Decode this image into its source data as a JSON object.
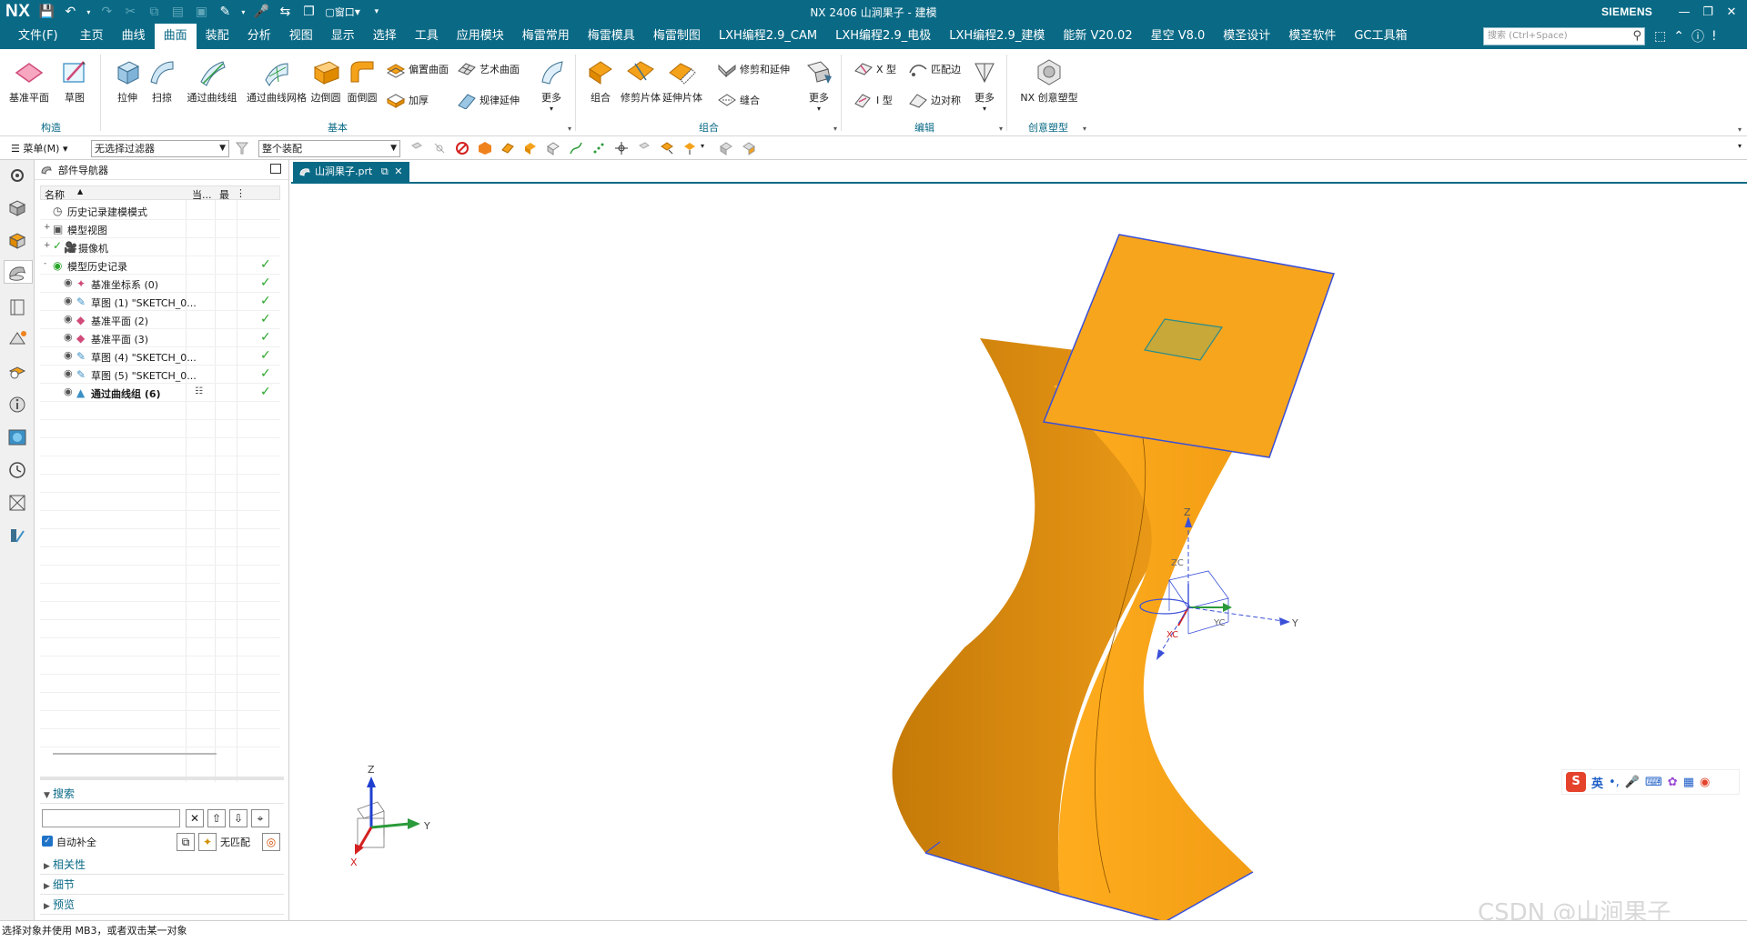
{
  "app": {
    "logo": "NX",
    "window_title": "NX 2406 山涧果子 - 建模",
    "brand": "SIEMENS",
    "window_menu_label": "窗口"
  },
  "menubar": {
    "items": [
      "文件(F)",
      "主页",
      "曲线",
      "曲面",
      "装配",
      "分析",
      "视图",
      "显示",
      "选择",
      "工具",
      "应用模块",
      "梅雷常用",
      "梅雷模具",
      "梅雷制图",
      "LXH编程2.9_CAM",
      "LXH编程2.9_电极",
      "LXH编程2.9_建模",
      "能新 V20.02",
      "星空 V8.0",
      "模圣设计",
      "模圣软件",
      "GC工具箱"
    ],
    "active": "曲面",
    "search_placeholder": "搜索 (Ctrl+Space)"
  },
  "ribbon": {
    "groups": {
      "construct": "构造",
      "basic": "基本",
      "combine": "组合",
      "edit": "编辑",
      "creative": "创意塑型"
    },
    "buttons": {
      "datum_plane": "基准平面",
      "sketch": "草图",
      "extrude": "拉伸",
      "sweep": "扫掠",
      "through_curves": "通过曲线组",
      "through_mesh": "通过曲线网格",
      "edge_blend": "边倒圆",
      "face_blend": "面倒圆",
      "offset_surface": "偏置曲面",
      "studio_surface": "艺术曲面",
      "thicken": "加厚",
      "law_extension": "规律延伸",
      "more_basic": "更多",
      "combine_btn": "组合",
      "trim_sheet": "修剪片体",
      "extend_sheet": "延伸片体",
      "trim_extend": "修剪和延伸",
      "sew": "缝合",
      "more_combine": "更多",
      "x_form": "X 型",
      "i_form": "I 型",
      "match_edge": "匹配边",
      "edge_symmetry": "边对称",
      "more_edit": "更多",
      "nx_creative": "NX 创意塑型"
    }
  },
  "toolbar": {
    "menu_label": "菜单(M)",
    "filter_value": "无选择过滤器",
    "scope_value": "整个装配"
  },
  "navigator": {
    "title": "部件导航器",
    "col_name": "名称",
    "col_current": "当...",
    "col_latest": "最",
    "rows": [
      {
        "label": "历史记录建模模式",
        "indent": 0,
        "expander": "",
        "check": false
      },
      {
        "label": "模型视图",
        "indent": 0,
        "expander": "+",
        "check": false
      },
      {
        "label": "摄像机",
        "indent": 0,
        "expander": "+",
        "check": false
      },
      {
        "label": "模型历史记录",
        "indent": 0,
        "expander": "-",
        "check": true
      },
      {
        "label": "基准坐标系 (0)",
        "indent": 1,
        "expander": "",
        "check": true
      },
      {
        "label": "草图 (1) \"SKETCH_0...",
        "indent": 1,
        "expander": "",
        "check": true
      },
      {
        "label": "基准平面 (2)",
        "indent": 1,
        "expander": "",
        "check": true
      },
      {
        "label": "基准平面 (3)",
        "indent": 1,
        "expander": "",
        "check": true
      },
      {
        "label": "草图 (4) \"SKETCH_0...",
        "indent": 1,
        "expander": "",
        "check": true
      },
      {
        "label": "草图 (5) \"SKETCH_0...",
        "indent": 1,
        "expander": "",
        "check": true
      },
      {
        "label": "通过曲线组 (6)",
        "indent": 1,
        "expander": "",
        "check": true
      }
    ],
    "search_section": "搜索",
    "auto_complete": "自动补全",
    "no_match": "无匹配",
    "sections": [
      "相关性",
      "细节",
      "预览"
    ]
  },
  "viewport": {
    "tab_label": "山涧果子.prt",
    "axis_z": "Z",
    "axis_y": "Y",
    "axis_zc": "ZC",
    "axis_yc": "YC",
    "axis_xc": "XC",
    "triad_z": "Z",
    "triad_y": "Y",
    "triad_x": "X"
  },
  "ime": {
    "lang": "英"
  },
  "status": {
    "text": "选择对象并使用 MB3，或者双击某一对象"
  },
  "watermark": "CSDN @山涧果子",
  "colors": {
    "title_bar": "#0a6a86",
    "part_orange": "#f5a21b",
    "edge_blue": "#3a50d8",
    "check_green": "#2aa52a"
  }
}
